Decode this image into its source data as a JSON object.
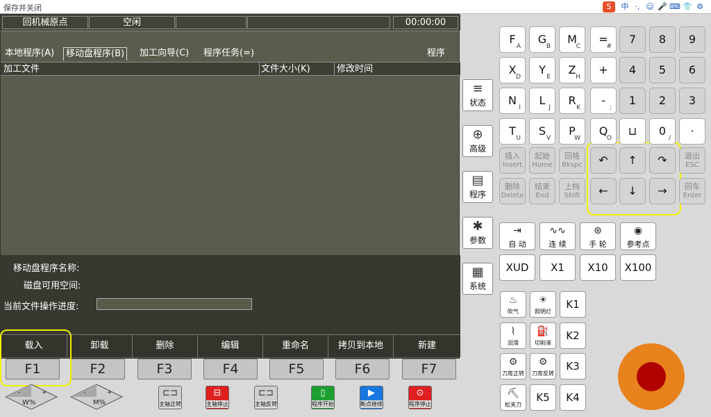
{
  "titlebar": {
    "title": "保存并关闭",
    "ime": [
      "中",
      "·,",
      "☺",
      "🎤",
      "⌨",
      "👕",
      "⚙"
    ]
  },
  "status": {
    "mode": "回机械原点",
    "state": "空闲",
    "time": "00:00:00"
  },
  "tabs": [
    "本地程序(A)",
    "移动盘程序(B)",
    "加工向导(C)",
    "程序任务(=)"
  ],
  "tabs_right": "程序",
  "columns": [
    "加工文件",
    "文件大小(K)",
    "修改时间"
  ],
  "info": {
    "name_label": "移动盘程序名称:",
    "space_label": "磁盘可用空间:",
    "progress_label": "当前文件操作进度:"
  },
  "softkeys": [
    "载入",
    "卸载",
    "删除",
    "编辑",
    "重命名",
    "拷贝到本地",
    "新建"
  ],
  "fkeys": [
    "F1",
    "F2",
    "F3",
    "F4",
    "F5",
    "F6",
    "F7"
  ],
  "side_buttons": [
    {
      "icon": "≡",
      "label": "状态"
    },
    {
      "icon": "⊕",
      "label": "高级"
    },
    {
      "icon": "▤",
      "label": "程序"
    },
    {
      "icon": "✱",
      "label": "参数"
    },
    {
      "icon": "▦",
      "label": "系统"
    }
  ],
  "keypad": [
    [
      {
        "m": "F",
        "s": "A"
      },
      {
        "m": "G",
        "s": "B"
      },
      {
        "m": "M",
        "s": "C"
      },
      {
        "m": "=",
        "s": "#"
      },
      {
        "m": "7",
        "s": ""
      },
      {
        "m": "8",
        "s": ""
      },
      {
        "m": "9",
        "s": ""
      }
    ],
    [
      {
        "m": "X",
        "s": "D"
      },
      {
        "m": "Y",
        "s": "E"
      },
      {
        "m": "Z",
        "s": "H"
      },
      {
        "m": "+",
        "s": ""
      },
      {
        "m": "4",
        "s": ""
      },
      {
        "m": "5",
        "s": ""
      },
      {
        "m": "6",
        "s": ""
      }
    ],
    [
      {
        "m": "N",
        "s": "I"
      },
      {
        "m": "L",
        "s": "J"
      },
      {
        "m": "R",
        "s": "K"
      },
      {
        "m": "-",
        "s": ";"
      },
      {
        "m": "1",
        "s": ""
      },
      {
        "m": "2",
        "s": ""
      },
      {
        "m": "3",
        "s": ""
      }
    ],
    [
      {
        "m": "T",
        "s": "U"
      },
      {
        "m": "S",
        "s": "V"
      },
      {
        "m": "P",
        "s": "W"
      },
      {
        "m": "Q",
        "s": "O"
      },
      {
        "m": "⊔",
        "s": ""
      },
      {
        "m": "0",
        "s": "/"
      },
      {
        "m": "·",
        "s": ""
      }
    ]
  ],
  "edit_keys": {
    "insert": {
      "cn": "插入",
      "en": "Insert"
    },
    "home": {
      "cn": "起始",
      "en": "Home"
    },
    "bksp": {
      "cn": "回格",
      "en": "Bkspc"
    },
    "esc": {
      "cn": "退出",
      "en": "ESC"
    },
    "delete": {
      "cn": "删除",
      "en": "Delete"
    },
    "end": {
      "cn": "结束",
      "en": "End"
    },
    "shift": {
      "cn": "上档",
      "en": "Shift"
    },
    "enter": {
      "cn": "回车",
      "en": "Enter"
    }
  },
  "arrows": {
    "pgup": "↶",
    "up": "↑",
    "pgdn": "↷",
    "left": "←",
    "down": "↓",
    "right": "→"
  },
  "modes": [
    {
      "icon": "⇥",
      "label": "自 动"
    },
    {
      "icon": "∿∿",
      "label": "连 续"
    },
    {
      "icon": "⊛",
      "label": "手 轮"
    },
    {
      "icon": "◉",
      "label": "参考点"
    }
  ],
  "increments": [
    "XUD",
    "X1",
    "X10",
    "X100"
  ],
  "aux": [
    {
      "icon": "♨",
      "label": "吹气"
    },
    {
      "icon": "☀",
      "label": "照明灯"
    },
    {
      "icon": "⌇",
      "label": "润滑"
    },
    {
      "icon": "⛽",
      "label": "切削液"
    },
    {
      "icon": "⚙",
      "label": "刀库正转"
    },
    {
      "icon": "⚙",
      "label": "刀库反转"
    },
    {
      "icon": "⛏",
      "label": "松夹刀"
    }
  ],
  "auxk": [
    "K1",
    "K2",
    "K3",
    "K4",
    "K5"
  ],
  "spindle": [
    {
      "icon": "⊏⊐",
      "label": "主轴正转",
      "color": "#cfcfcf"
    },
    {
      "icon": "⊟",
      "label": "主轴停止",
      "color": "#e02020"
    },
    {
      "icon": "⊏⊐",
      "label": "主轴反转",
      "color": "#cfcfcf"
    },
    {
      "icon": "▯",
      "label": "程序开始",
      "color": "#1ca030"
    },
    {
      "icon": "▶",
      "label": "断点继续",
      "color": "#1878e0"
    },
    {
      "icon": "⊙",
      "label": "程序停止",
      "color": "#e02020"
    }
  ],
  "estop": {
    "outer": "#e8821c",
    "inner": "#b00000"
  },
  "overrides": [
    {
      "label": "W%"
    },
    {
      "label": "M%"
    }
  ],
  "highlight_color": "#f0f000"
}
